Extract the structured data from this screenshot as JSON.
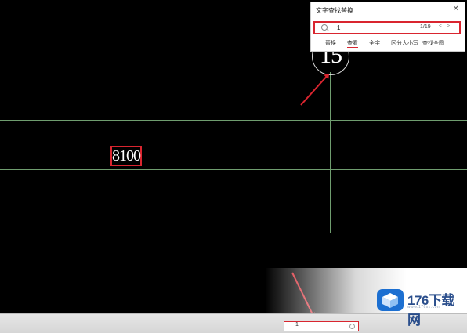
{
  "drawing": {
    "grid_label": "15",
    "dimension_text": "8100"
  },
  "find_dialog": {
    "title": "文字查找替换",
    "close_icon": "close-icon",
    "search": {
      "icon": "search-icon",
      "value": "1",
      "count": "1/19",
      "nav": "< >"
    },
    "options": [
      "替换",
      "查看",
      "全字",
      "区分大小写",
      "查找全图"
    ]
  },
  "taskbar": {
    "search_value": "1",
    "search_icon": "search-icon"
  },
  "watermark": {
    "brand": "176下载网",
    "url": "www.176xz.com"
  },
  "colors": {
    "background": "#000000",
    "highlight": "#d9252f",
    "grid_line": "#6f9d6f",
    "brand": "#2a4e8c"
  }
}
